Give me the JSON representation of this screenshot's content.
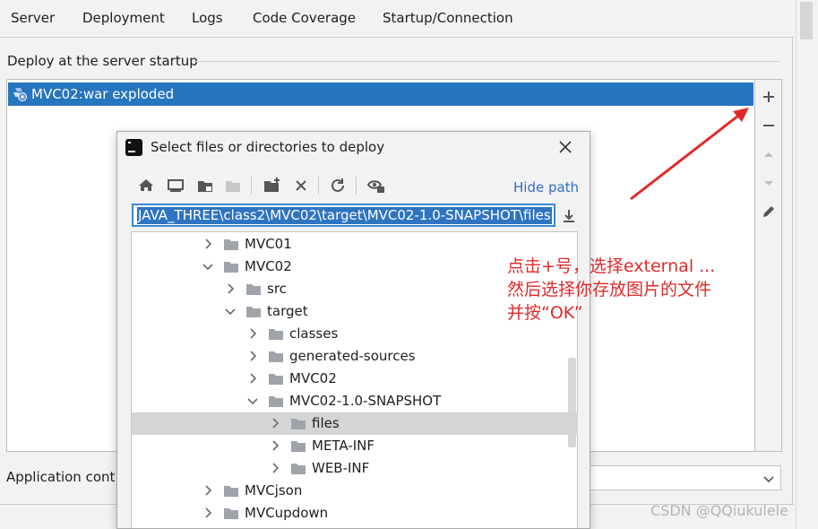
{
  "tabs": [
    "Server",
    "Deployment",
    "Logs",
    "Code Coverage",
    "Startup/Connection"
  ],
  "active_tab": "Deployment",
  "deploy": {
    "section_title": "Deploy at the server startup",
    "items": [
      "MVC02:war exploded"
    ],
    "side_buttons": [
      "plus-icon",
      "minus-icon",
      "arrow-up-icon",
      "arrow-down-icon",
      "pencil-icon"
    ]
  },
  "app_context": {
    "label": "Application cont"
  },
  "dialog": {
    "title": "Select files or directories to deploy",
    "hide_path": "Hide path",
    "path_value": "JAVA_THREE\\class2\\MVC02\\target\\MVC02-1.0-SNAPSHOT\\files",
    "toolbar_icons": [
      "home-icon",
      "desktop-icon",
      "project-folder-icon",
      "module-folder-icon",
      "new-folder-icon",
      "delete-icon",
      "refresh-icon",
      "show-hidden-icon"
    ],
    "tree": [
      {
        "name": "MVC01",
        "level": 0,
        "expanded": false,
        "selected": false
      },
      {
        "name": "MVC02",
        "level": 0,
        "expanded": true,
        "selected": false
      },
      {
        "name": "src",
        "level": 1,
        "expanded": false,
        "selected": false
      },
      {
        "name": "target",
        "level": 1,
        "expanded": true,
        "selected": false
      },
      {
        "name": "classes",
        "level": 2,
        "expanded": false,
        "selected": false
      },
      {
        "name": "generated-sources",
        "level": 2,
        "expanded": false,
        "selected": false
      },
      {
        "name": "MVC02",
        "level": 2,
        "expanded": false,
        "selected": false
      },
      {
        "name": "MVC02-1.0-SNAPSHOT",
        "level": 2,
        "expanded": true,
        "selected": false
      },
      {
        "name": "files",
        "level": 3,
        "expanded": false,
        "selected": true
      },
      {
        "name": "META-INF",
        "level": 3,
        "expanded": false,
        "selected": false
      },
      {
        "name": "WEB-INF",
        "level": 3,
        "expanded": false,
        "selected": false
      },
      {
        "name": "MVCjson",
        "level": 0,
        "expanded": false,
        "selected": false
      },
      {
        "name": "MVCupdown",
        "level": 0,
        "expanded": false,
        "selected": false
      }
    ]
  },
  "annotation": {
    "lines": [
      "点击+号，选择external ...",
      "然后选择你存放图片的文件",
      "并按“OK”"
    ],
    "color": "#e02a2a"
  },
  "watermark": "CSDN @QQiukulele",
  "colors": {
    "accent": "#2675bf",
    "link": "#2f6ec3",
    "selection": "#d5d5d5"
  }
}
